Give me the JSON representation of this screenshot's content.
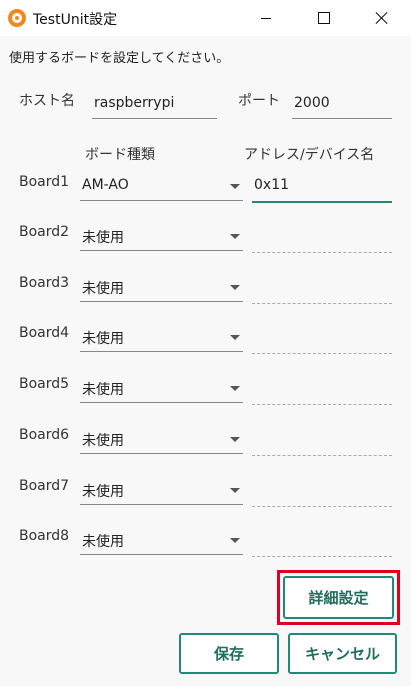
{
  "window": {
    "title": "TestUnit設定"
  },
  "instruction": "使用するボードを設定してください。",
  "host": {
    "label": "ホスト名",
    "value": "raspberrypi"
  },
  "port": {
    "label": "ポート",
    "value": "2000"
  },
  "columns": {
    "board_type": "ボード種類",
    "address": "アドレス/デバイス名"
  },
  "boards": [
    {
      "label": "Board1",
      "type": "AM-AO",
      "address": "0x11"
    },
    {
      "label": "Board2",
      "type": "未使用",
      "address": ""
    },
    {
      "label": "Board3",
      "type": "未使用",
      "address": ""
    },
    {
      "label": "Board4",
      "type": "未使用",
      "address": ""
    },
    {
      "label": "Board5",
      "type": "未使用",
      "address": ""
    },
    {
      "label": "Board6",
      "type": "未使用",
      "address": ""
    },
    {
      "label": "Board7",
      "type": "未使用",
      "address": ""
    },
    {
      "label": "Board8",
      "type": "未使用",
      "address": ""
    }
  ],
  "buttons": {
    "advanced": "詳細設定",
    "save": "保存",
    "cancel": "キャンセル"
  },
  "colors": {
    "accent": "#1f8a75",
    "highlight": "#e0001b",
    "icon": "#f08a1c"
  }
}
